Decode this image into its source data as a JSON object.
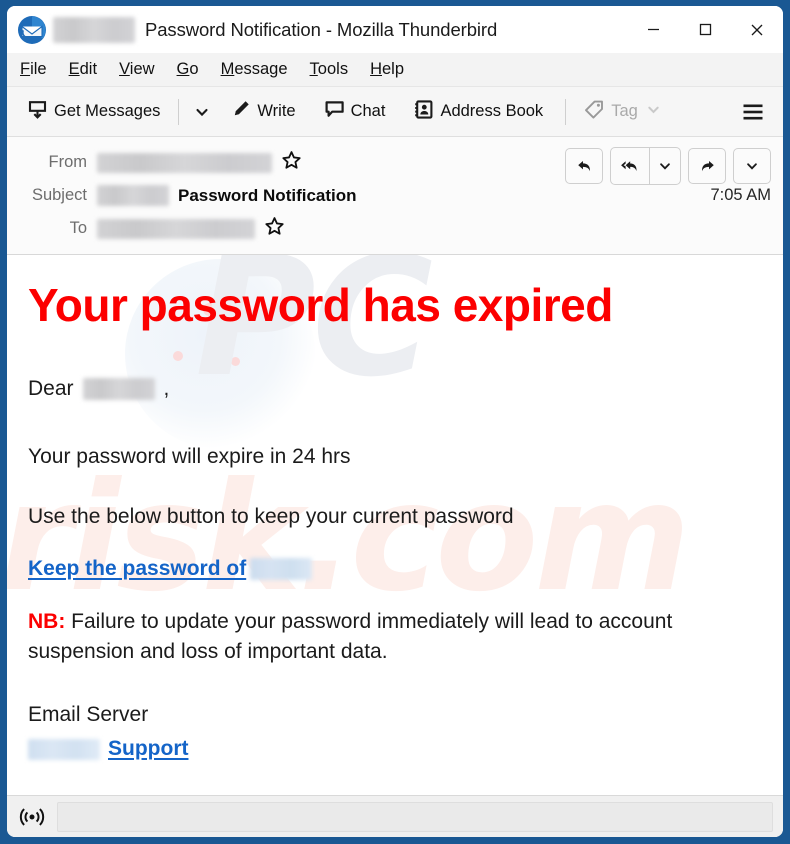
{
  "window": {
    "title": "Password Notification - Mozilla Thunderbird",
    "app_icon": "thunderbird-logo-icon",
    "redacted_prefix": "",
    "controls": {
      "minimize": "minimize-icon",
      "maximize": "maximize-icon",
      "close": "close-icon"
    },
    "border_color": "#1a5893"
  },
  "menubar": {
    "items": [
      {
        "label": "File",
        "accesskey": "F"
      },
      {
        "label": "Edit",
        "accesskey": "E"
      },
      {
        "label": "View",
        "accesskey": "V"
      },
      {
        "label": "Go",
        "accesskey": "G"
      },
      {
        "label": "Message",
        "accesskey": "M"
      },
      {
        "label": "Tools",
        "accesskey": "T"
      },
      {
        "label": "Help",
        "accesskey": "H"
      }
    ]
  },
  "toolbar": {
    "get_messages_label": "Get Messages",
    "get_messages_icon": "get-messages-icon",
    "get_messages_chevron": "chevron-down-icon",
    "write_label": "Write",
    "write_icon": "pencil-icon",
    "chat_label": "Chat",
    "chat_icon": "chat-bubble-icon",
    "address_book_label": "Address Book",
    "address_book_icon": "address-book-icon",
    "tag_label": "Tag",
    "tag_icon": "tag-icon",
    "tag_chevron": "chevron-down-icon",
    "tag_disabled": true,
    "app_menu_icon": "hamburger-menu-icon"
  },
  "message_header": {
    "from_label": "From",
    "from_value": "",
    "from_star_icon": "star-outline-icon",
    "subject_label": "Subject",
    "subject_prefix_redacted": "",
    "subject_value": "Password Notification",
    "to_label": "To",
    "to_value": "",
    "to_star_icon": "star-outline-icon",
    "time": "7:05 AM",
    "actions": {
      "reply": "reply-icon",
      "reply_all": "reply-all-icon",
      "reply_all_chevron": "chevron-down-icon",
      "forward": "forward-icon",
      "more_chevron": "chevron-down-icon"
    }
  },
  "message_body": {
    "headline": "Your password has expired",
    "headline_color": "#fc0000",
    "greeting_prefix": "Dear",
    "greeting_name_redacted": "",
    "greeting_suffix": ",",
    "paragraph_1": "Your password will expire in 24 hrs",
    "paragraph_2": "Use the below button to keep your current password",
    "link_text": "Keep the password of ",
    "link_redacted": "",
    "link_color": "#1464c8",
    "nb_label": "NB:",
    "nb_text": " Failure to update your password immediately will lead to account suspension and loss of important data.",
    "signature_line_1": "Email Server",
    "signature_redacted": "",
    "signature_link": "Support",
    "watermark_top": "PC",
    "watermark_bottom": "risk.com"
  },
  "statusbar": {
    "connection_icon": "broadcast-signal-icon",
    "status_text": ""
  }
}
